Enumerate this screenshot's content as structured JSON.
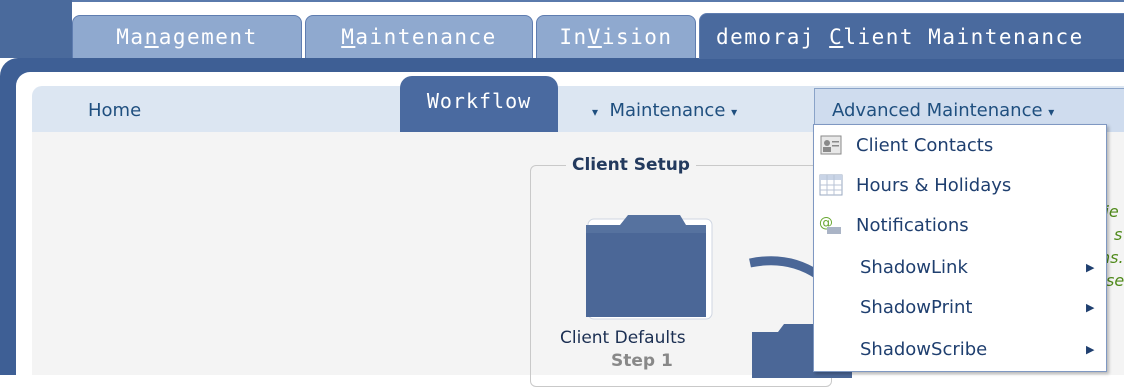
{
  "top_tabs": [
    {
      "label": "Management",
      "underline": "n"
    },
    {
      "label": "Maintenance",
      "underline": "M"
    },
    {
      "label": "InVision",
      "underline": "V"
    },
    {
      "label": "demoraj Client Maintenance",
      "underline": "C"
    }
  ],
  "subnav": {
    "home": "Home",
    "workflow": "Workflow",
    "maintenance": "Maintenance",
    "advanced_maintenance": "Advanced Maintenance"
  },
  "client_setup": {
    "legend": "Client Setup",
    "step1_title": "Client Defaults",
    "step1_sub": "Step 1"
  },
  "green_text": [
    "lie",
    "s",
    "ns.",
    "se"
  ],
  "dropdown": {
    "items": [
      {
        "label": "Client Contacts",
        "icon": "contacts-icon",
        "submenu": false
      },
      {
        "label": "Hours & Holidays",
        "icon": "calendar-grid-icon",
        "submenu": false
      },
      {
        "label": "Notifications",
        "icon": "notification-icon",
        "submenu": false
      },
      {
        "label": "ShadowLink",
        "icon": "",
        "submenu": true
      },
      {
        "label": "ShadowPrint",
        "icon": "",
        "submenu": true
      },
      {
        "label": "ShadowScribe",
        "icon": "",
        "submenu": true
      }
    ]
  },
  "colors": {
    "frame": "#3e5f95",
    "tab_inactive": "#8fa9cf",
    "tab_active": "#4a6a9e",
    "link": "#1f4f7f"
  }
}
